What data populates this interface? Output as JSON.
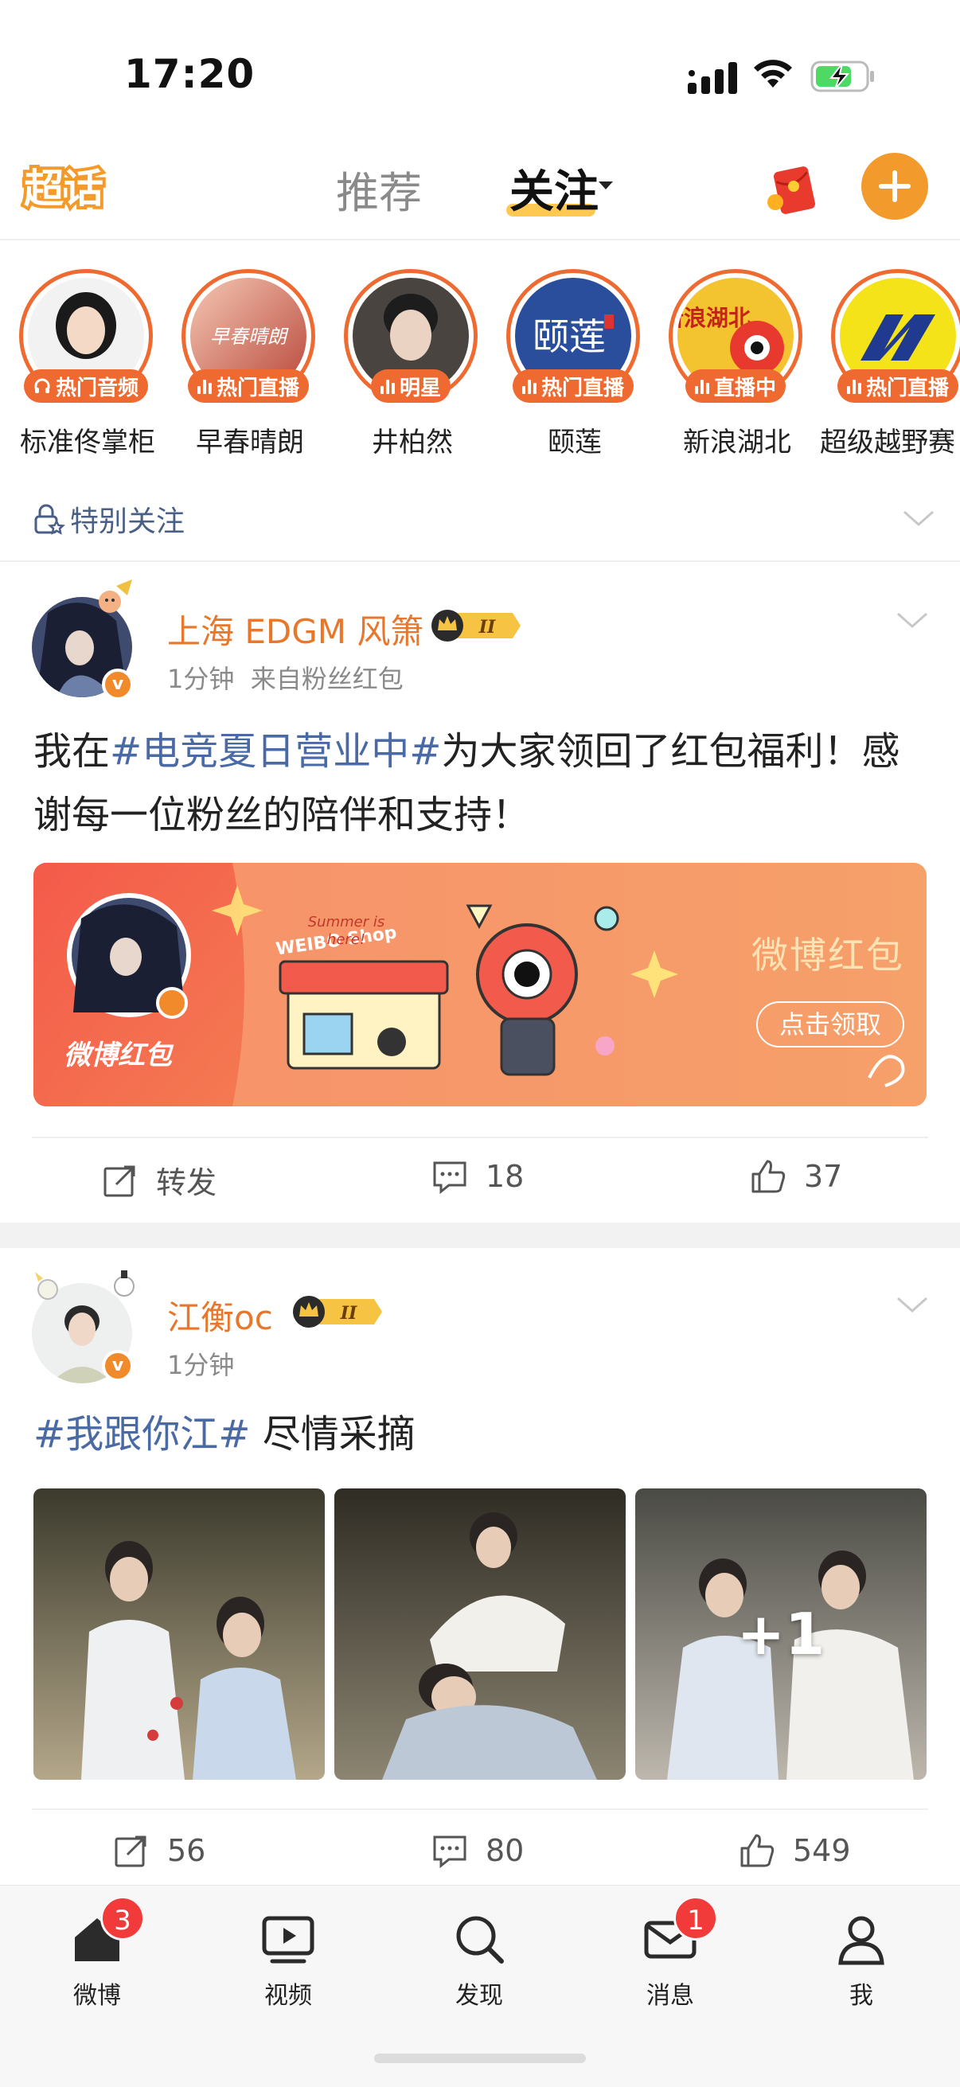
{
  "status_bar": {
    "time": "17:20"
  },
  "nav": {
    "logo_text": "超话",
    "tabs": [
      {
        "label": "推荐"
      },
      {
        "label": "关注"
      }
    ],
    "active_tab": "关注",
    "accent": "#f39a2c"
  },
  "stories": [
    {
      "name": "标准佟掌柜",
      "badge": "热门音频",
      "badge_icon": "headphone-icon"
    },
    {
      "name": "早春晴朗",
      "badge": "热门直播",
      "badge_icon": "live-bars-icon",
      "cover_text": "早春晴朗"
    },
    {
      "name": "井柏然",
      "badge": "明星",
      "badge_icon": "live-bars-icon"
    },
    {
      "name": "颐莲",
      "badge": "热门直播",
      "badge_icon": "live-bars-icon",
      "cover_text": "颐莲"
    },
    {
      "name": "新浪湖北",
      "badge": "直播中",
      "badge_icon": "live-bars-icon",
      "cover_text": "新浪湖北"
    },
    {
      "name": "超级越野赛",
      "badge": "热门直播",
      "badge_icon": "live-bars-icon"
    }
  ],
  "special_follow": {
    "label": "特别关注"
  },
  "posts": [
    {
      "user": "上海 EDGM 风箫",
      "level_badge": "II",
      "time": "1分钟",
      "source": "来自粉丝红包",
      "content_prefix": "我在",
      "topic": "#电竞夏日营业中#",
      "content_suffix": "为大家领回了红包福利！感谢每一位粉丝的陪伴和支持！",
      "banner": {
        "left_label": "微博红包",
        "shop_sign": "WEIBO Shop",
        "bubble": "Summer is here!",
        "title": "微博红包",
        "button": "点击领取"
      },
      "actions": {
        "repost": "转发",
        "comments": "18",
        "likes": "37"
      }
    },
    {
      "user": "江衡oc",
      "level_badge": "II",
      "time": "1分钟",
      "topic": "#我跟你江#",
      "content_suffix": " 尽情采摘",
      "more_photos": "+1",
      "actions": {
        "repost": "56",
        "comments": "80",
        "likes": "549"
      }
    }
  ],
  "tabbar": {
    "items": [
      {
        "label": "微博",
        "icon": "home-icon",
        "badge": "3"
      },
      {
        "label": "视频",
        "icon": "video-icon"
      },
      {
        "label": "发现",
        "icon": "search-icon"
      },
      {
        "label": "消息",
        "icon": "mail-icon",
        "badge": "1"
      },
      {
        "label": "我",
        "icon": "person-icon"
      }
    ]
  },
  "colors": {
    "orange": "#e8772b",
    "topic_blue": "#4a6aa5",
    "badge_red": "#f13b3b",
    "story_ring": "#ef6a30"
  }
}
